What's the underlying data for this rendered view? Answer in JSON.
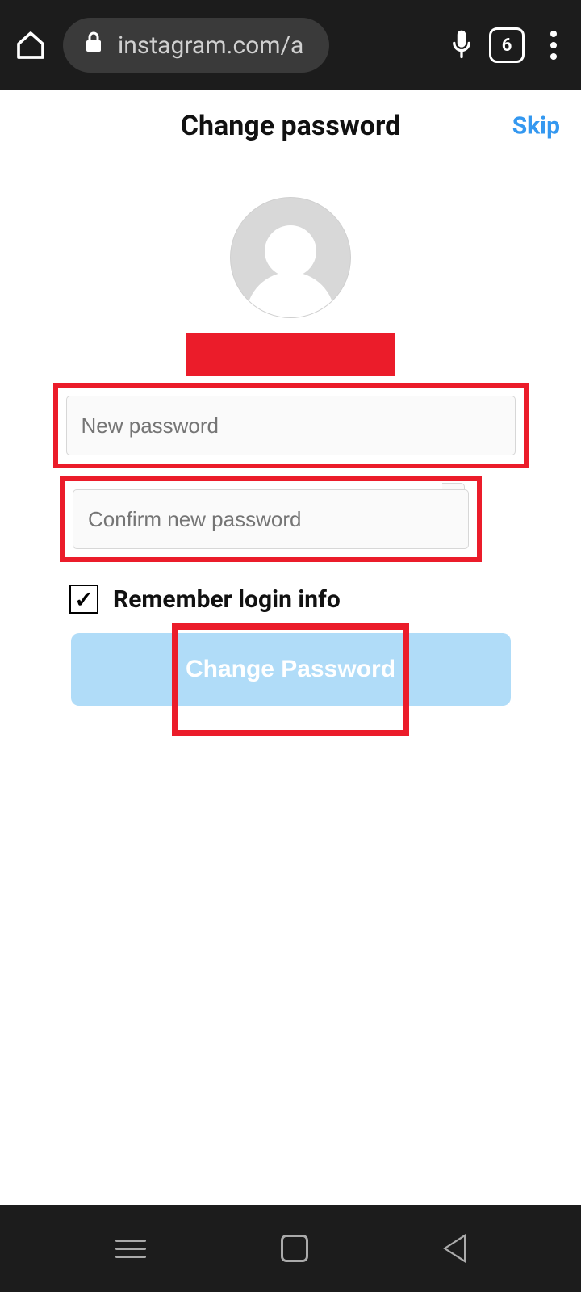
{
  "browser": {
    "url_display": "instagram.com/a",
    "tab_count": "6"
  },
  "header": {
    "title": "Change password",
    "skip": "Skip"
  },
  "form": {
    "new_password_placeholder": "New password",
    "confirm_password_placeholder": "Confirm new password",
    "remember_label": "Remember login info",
    "remember_checked": true,
    "submit_label": "Change Password"
  },
  "highlights": {
    "color": "#eb1c2a"
  }
}
